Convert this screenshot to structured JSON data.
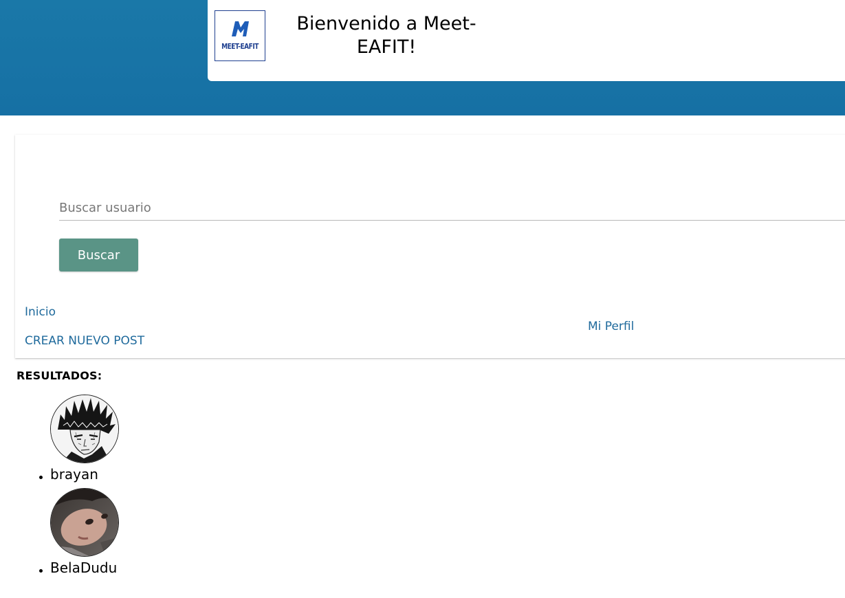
{
  "header": {
    "title": "Bienvenido a Meet-EAFIT!",
    "logo_text": "MEET-EAFIT"
  },
  "search": {
    "placeholder": "Buscar usuario",
    "value": "",
    "button_label": "Buscar"
  },
  "nav": {
    "home_label": "Inicio",
    "new_post_label": "CREAR NUEVO POST",
    "profile_label": "Mi Perfil"
  },
  "results": {
    "heading": "RESULTADOS:",
    "users": [
      {
        "username": "brayan",
        "avatar": "manga-portrait-avatar"
      },
      {
        "username": "BelaDudu",
        "avatar": "selfie-portrait-avatar"
      }
    ]
  },
  "colors": {
    "brand_blue": "#1670a4",
    "button_green": "#5a9486",
    "link_blue": "#1f6a9c"
  }
}
